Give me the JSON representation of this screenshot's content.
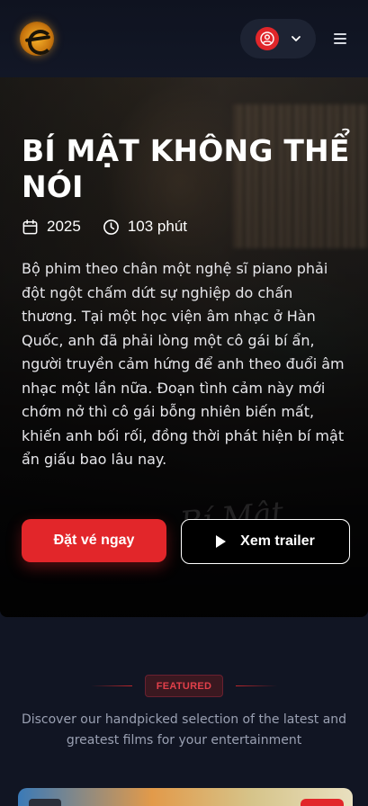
{
  "header": {
    "logo_icon": "cinema-logo-icon",
    "user_icon": "user-circle-icon",
    "dropdown_icon": "chevron-down-icon",
    "menu_icon": "hamburger-menu-icon"
  },
  "hero": {
    "title": "BÍ MẬT KHÔNG THỂ NÓI",
    "year": "2025",
    "duration": "103 phút",
    "description": "Bộ phim theo chân một nghệ sĩ piano phải đột ngột chấm dứt sự nghiệp do chấn thương. Tại một học viện âm nhạc ở Hàn Quốc, anh đã phải lòng một cô gái bí ẩn, người truyền cảm hứng để anh theo đuổi âm nhạc một lần nữa. Đoạn tình cảm này mới chớm nở thì cô gái bỗng nhiên biến mất, khiến anh bối rối, đồng thời phát hiện bí mật ẩn giấu bao lâu nay.",
    "book_button": "Đặt vé ngay",
    "trailer_button": "Xem trailer"
  },
  "featured": {
    "badge": "FEATURED",
    "text": "Discover our handpicked selection of the latest and greatest films for your entertainment"
  },
  "colors": {
    "accent": "#e2262a",
    "background": "#111523"
  }
}
